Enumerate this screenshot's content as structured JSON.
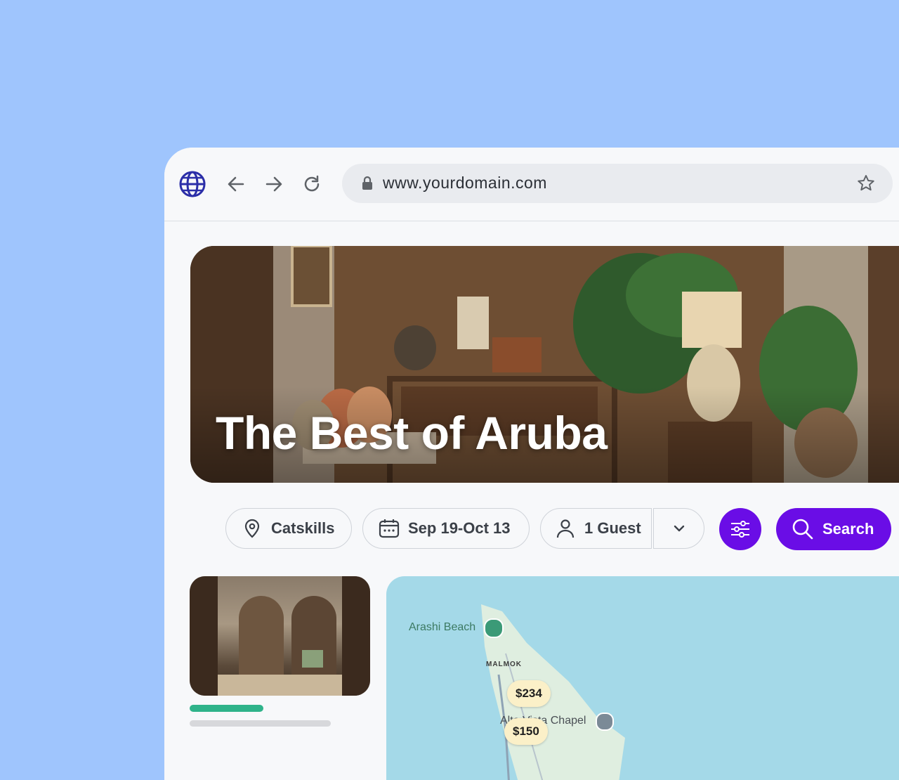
{
  "browser": {
    "url": "www.yourdomain.com"
  },
  "hero": {
    "title": "The Best of Aruba"
  },
  "filters": {
    "location": "Catskills",
    "dates": "Sep 19-Oct 13",
    "guests": "1 Guest",
    "search_label": "Search"
  },
  "map": {
    "labels": {
      "beach": "Arashi Beach",
      "district": "MALMOK",
      "chapel": "Alto Vista Chapel"
    },
    "prices": [
      "$234",
      "$150"
    ]
  },
  "colors": {
    "background": "#9fc5fd",
    "accent": "#6a0de6",
    "progress": "#2fb38a",
    "map_water": "#a4d9e8"
  },
  "icons": {
    "globe": "globe-icon",
    "back": "arrow-left-icon",
    "forward": "arrow-right-icon",
    "reload": "reload-icon",
    "lock": "lock-icon",
    "star": "star-icon",
    "location": "map-pin-icon",
    "calendar": "calendar-icon",
    "person": "person-icon",
    "chevron": "chevron-down-icon",
    "filter": "sliders-icon",
    "search": "search-icon"
  }
}
